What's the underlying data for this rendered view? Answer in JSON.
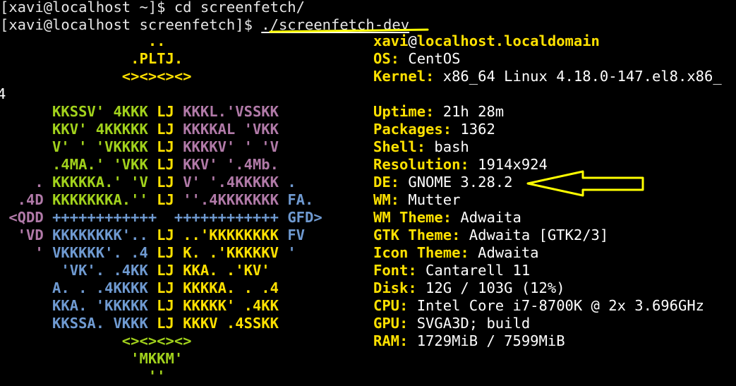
{
  "prompt": {
    "line1": "[xavi@localhost ~]$ cd screenfetch/",
    "line2_prefix": "[xavi@localhost screenfetch]$ ",
    "line2_cmd": "./screenfetch-dev"
  },
  "wrap_fragment": "4",
  "host": {
    "user": "xavi",
    "at": "@",
    "name": "localhost.localdomain"
  },
  "info": [
    {
      "key": "OS:",
      "value": " CentOS"
    },
    {
      "key": "Kernel:",
      "value": " x86_64 Linux 4.18.0-147.el8.x86_"
    },
    {
      "key": "Uptime:",
      "value": " 21h 28m"
    },
    {
      "key": "Packages:",
      "value": " 1362"
    },
    {
      "key": "Shell:",
      "value": " bash"
    },
    {
      "key": "Resolution:",
      "value": " 1914x924"
    },
    {
      "key": "DE:",
      "value": " GNOME 3.28.2"
    },
    {
      "key": "WM:",
      "value": " Mutter"
    },
    {
      "key": "WM Theme:",
      "value": " Adwaita"
    },
    {
      "key": "GTK Theme:",
      "value": " Adwaita [GTK2/3]"
    },
    {
      "key": "Icon Theme:",
      "value": " Adwaita"
    },
    {
      "key": "Font:",
      "value": " Cantarell 11"
    },
    {
      "key": "Disk:",
      "value": " 12G / 103G (12%)"
    },
    {
      "key": "CPU:",
      "value": " Intel Core i7-8700K @ 2x 3.696GHz"
    },
    {
      "key": "GPU:",
      "value": " SVGA3D; build"
    },
    {
      "key": "RAM:",
      "value": " 1729MiB / 7599MiB"
    }
  ],
  "logo": [
    [
      [
        "y",
        "                 .."
      ]
    ],
    [
      [
        "y",
        "               .PLTJ."
      ]
    ],
    [
      [
        "y",
        "              <><><><>"
      ]
    ],
    [],
    [
      [
        "g",
        "      KKSSV' 4KKK "
      ],
      [
        "y",
        "LJ "
      ],
      [
        "p",
        "KKKL.'VSSKK"
      ]
    ],
    [
      [
        "g",
        "      KKV' 4KKKKK "
      ],
      [
        "y",
        "LJ "
      ],
      [
        "p",
        "KKKKAL 'VKK"
      ]
    ],
    [
      [
        "g",
        "      V' ' 'VKKKK "
      ],
      [
        "y",
        "LJ "
      ],
      [
        "p",
        "KKKKV' ' 'V"
      ]
    ],
    [
      [
        "g",
        "      .4MA.' 'VKK "
      ],
      [
        "y",
        "LJ "
      ],
      [
        "p",
        "KKV' '.4Mb."
      ]
    ],
    [
      [
        "p",
        "    . "
      ],
      [
        "g",
        "KKKKKA.' 'V "
      ],
      [
        "y",
        "LJ "
      ],
      [
        "p",
        "V' '.4KKKKK "
      ],
      [
        "b",
        "."
      ]
    ],
    [
      [
        "p",
        "  .4D "
      ],
      [
        "g",
        "KKKKKKKA.'' "
      ],
      [
        "y",
        "LJ "
      ],
      [
        "p",
        "''.4KKKKKKK "
      ],
      [
        "b",
        "FA."
      ]
    ],
    [
      [
        "p",
        " <QDD "
      ],
      [
        "b",
        "++++++++++++  ++++++++++++ "
      ],
      [
        "b",
        "GFD>"
      ]
    ],
    [
      [
        "p",
        "  'VD "
      ],
      [
        "b",
        "KKKKKKKK'.. "
      ],
      [
        "y",
        "LJ "
      ],
      [
        "y",
        "..'KKKKKKKK "
      ],
      [
        "b",
        "FV"
      ]
    ],
    [
      [
        "p",
        "    ' "
      ],
      [
        "b",
        "VKKKKK'. .4 "
      ],
      [
        "y",
        "LJ "
      ],
      [
        "y",
        "K. .'KKKKKV "
      ],
      [
        "b",
        "'"
      ]
    ],
    [
      [
        "b",
        "       'VK'. .4KK "
      ],
      [
        "y",
        "LJ "
      ],
      [
        "y",
        "KKA. .'KV'"
      ]
    ],
    [
      [
        "b",
        "      A. . .4KKKK "
      ],
      [
        "y",
        "LJ "
      ],
      [
        "y",
        "KKKKA. . .4"
      ]
    ],
    [
      [
        "b",
        "      KKA. 'KKKKK "
      ],
      [
        "y",
        "LJ "
      ],
      [
        "y",
        "KKKKK' .4KK"
      ]
    ],
    [
      [
        "b",
        "      KKSSA. VKKK "
      ],
      [
        "y",
        "LJ "
      ],
      [
        "y",
        "KKKV .4SSKK"
      ]
    ],
    [
      [
        "g",
        "              <><><><>"
      ]
    ],
    [
      [
        "g",
        "               'MKKM'"
      ]
    ],
    [
      [
        "g",
        "                 ''"
      ]
    ]
  ],
  "colors": {
    "background": "#000000",
    "yellow": "#ffe100",
    "green": "#a2d21c",
    "purple": "#b17aa8",
    "blue": "#6f9ad1",
    "annotation": "#ffff00"
  }
}
